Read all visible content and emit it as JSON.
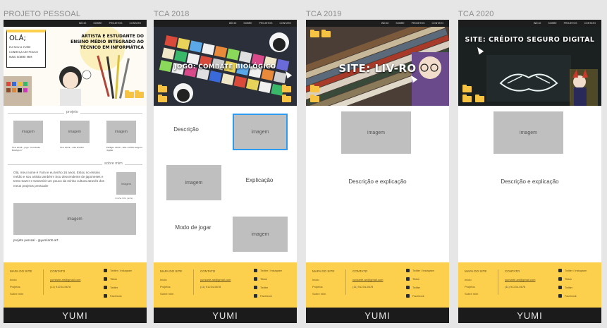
{
  "frames": [
    {
      "label": "PROJETO PESSOAL",
      "nav": [
        "INÍCIO",
        "SOBRE",
        "PROJETOS",
        "CONTATO"
      ],
      "hero": {
        "greeting": "OLÁ;",
        "greeting_lines": [
          "EU SOU A YUMI!",
          "CONHEÇA UM POUCO",
          "MAIS SOBRE MIM"
        ],
        "title": "ARTISTA E ESTUDANTE DO ENSINO MÉDIO INTEGRADO AO TÉCNICO EM INFORMÁTICA"
      },
      "section_projects": "projeto",
      "project_images": [
        "imagem",
        "imagem",
        "imagem"
      ],
      "project_captions": [
        "TCA 2018 - jogo \"Combate Biológico\"",
        "TCA 2019 - site LIV-RO",
        "Estágio 2020 - Site crédito seguro digital"
      ],
      "section_about": "sobre mim",
      "about_text": "Olá, meu nome é Yumi e eu tenho 16 anos. Estou no ensino médio e sou artista também! Sou descendente de japoneses e tento trazer e transmitir um pouco da minha cultura através dos meus projetos pessoais!",
      "about_image": "imagem",
      "about_caption": "minha foto (arte)",
      "big_image": "imagem",
      "credit": "projeto pessoal - @yumiarte.art"
    },
    {
      "label": "TCA 2018",
      "nav": [
        "INÍCIO",
        "SOBRE",
        "PROJETOS",
        "CONTATO"
      ],
      "hero": {
        "title": "JOGO: COMBATE BIOLÓGICO"
      },
      "descricao": "Descrição",
      "image1": "imagem",
      "image2": "imagem",
      "explicacao": "Explicação",
      "modo": "Modo de jogar",
      "image3": "imagem"
    },
    {
      "label": "TCA 2019",
      "nav": [
        "INÍCIO",
        "SOBRE",
        "PROJETOS",
        "CONTATO"
      ],
      "hero": {
        "title": "SITE: LIV-RO"
      },
      "image": "imagem",
      "text": "Descrição e explicação"
    },
    {
      "label": "TCA 2020",
      "nav": [
        "INÍCIO",
        "SOBRE",
        "PROJETOS",
        "CONTATO"
      ],
      "hero": {
        "title": "SITE: CRÉDITO SEGURO DIGITAL"
      },
      "image": "imagem",
      "text": "Descrição e explicação"
    }
  ],
  "footer": {
    "map_title": "MAPA DO SITE",
    "map_links": [
      "Início",
      "Projetos",
      "Sobre mim"
    ],
    "contact_title": "CONTATO",
    "contact_email": "yumiarte.art@gmail.com",
    "contact_phone": "(11) 91234-5678",
    "socials": [
      "Twitter / Instagram",
      "Tiktok",
      "Twitter",
      "Facebook"
    ],
    "brand": "YUMI"
  },
  "colors": {
    "footer_yellow": "#fccf4d",
    "topbar_dark": "#1d1d1d",
    "selected_blue": "#2d9bf0",
    "placeholder_gray": "#bfbfbf"
  }
}
